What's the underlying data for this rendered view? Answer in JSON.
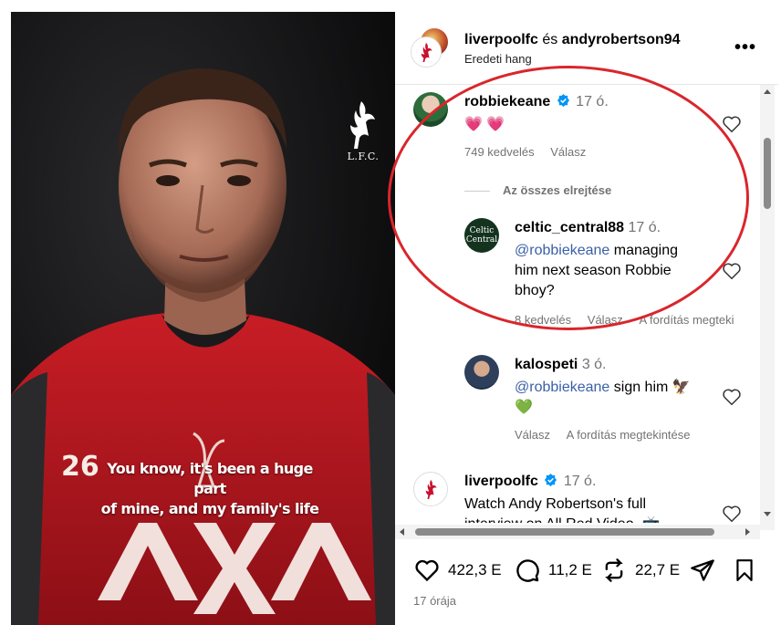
{
  "video": {
    "subtitle_line1": "You know, it's been a huge part",
    "subtitle_line2": "of mine, and my family's life",
    "jersey_number": "26",
    "sponsor": "AXA",
    "club_logo_text": "L.F.C."
  },
  "header": {
    "user1": "liverpoolfc",
    "connector": "és",
    "user2": "andyrobertson94",
    "audio": "Eredeti hang",
    "more_icon": "more-horizontal-icon"
  },
  "comments": [
    {
      "username": "robbiekeane",
      "verified": true,
      "time": "17 ó.",
      "text": "💗 💗",
      "likes": "749 kedvelés",
      "reply": "Válasz",
      "hide_replies": "Az összes elrejtése"
    },
    {
      "username": "celtic_central88",
      "time": "17 ó.",
      "mention": "@robbiekeane",
      "text_line1": " managing",
      "text_line2": "him next season Robbie",
      "text_line3": "bhoy?",
      "likes": "8 kedvelés",
      "reply": "Válasz",
      "translate": "A fordítás megteki",
      "avatar_text1": "Celtic",
      "avatar_text2": "Central"
    },
    {
      "username": "kalospeti",
      "time": "3 ó.",
      "mention": "@robbiekeane",
      "text": " sign him 🦅",
      "text_line2": "💚",
      "reply": "Válasz",
      "translate": "A fordítás megtekintése"
    },
    {
      "username": "liverpoolfc",
      "verified": true,
      "time": "17 ó.",
      "text_line1": "Watch Andy Robertson's full",
      "text_line2": "interview on All Red Video. 📺"
    }
  ],
  "actions": {
    "likes": "422,3 E",
    "comments": "11,2 E",
    "reposts": "22,7 E"
  },
  "post_time": "17 órája",
  "colors": {
    "annotation_ring": "#d9262c",
    "mention": "#3a5fa8",
    "jersey_red": "#b3161f",
    "verified": "#0095f6"
  }
}
